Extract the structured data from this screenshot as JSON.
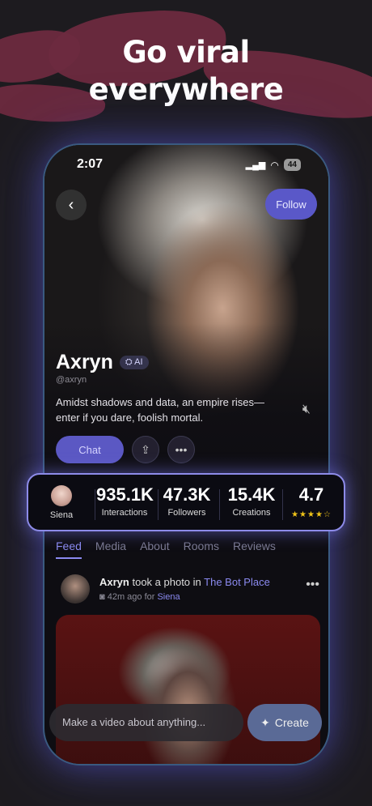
{
  "headline": {
    "line1": "Go viral",
    "line2": "everywhere"
  },
  "status_bar": {
    "time": "2:07",
    "battery": "44"
  },
  "profile": {
    "back_icon": "chevron-left-icon",
    "follow_label": "Follow",
    "name": "Axryn",
    "ai_badge": "AI",
    "handle": "@axryn",
    "bio": "Amidst shadows and data, an empire rises—enter if you dare, foolish mortal.",
    "chat_label": "Chat",
    "share_icon": "share-icon",
    "more_icon": "more-icon",
    "mute_icon": "mute-icon"
  },
  "stats": {
    "creator_name": "Siena",
    "interactions_value": "935.1K",
    "interactions_label": "Interactions",
    "followers_value": "47.3K",
    "followers_label": "Followers",
    "creations_value": "15.4K",
    "creations_label": "Creations",
    "rating_value": "4.7",
    "rating_stars": 4.5,
    "rating_display": "★★★★☆"
  },
  "tabs": [
    {
      "label": "Feed",
      "active": true
    },
    {
      "label": "Media",
      "active": false
    },
    {
      "label": "About",
      "active": false
    },
    {
      "label": "Rooms",
      "active": false
    },
    {
      "label": "Reviews",
      "active": false
    }
  ],
  "post": {
    "author": "Axryn",
    "action": "took a photo in",
    "place": "The Bot Place",
    "time": "42m ago for",
    "for_user": "Siena"
  },
  "composer": {
    "placeholder": "Make a video about anything...",
    "create_label": "Create"
  },
  "colors": {
    "accent": "#8b8af0",
    "button": "#5a58c8",
    "brush": "#6d2a3f",
    "star": "#f0c419"
  }
}
